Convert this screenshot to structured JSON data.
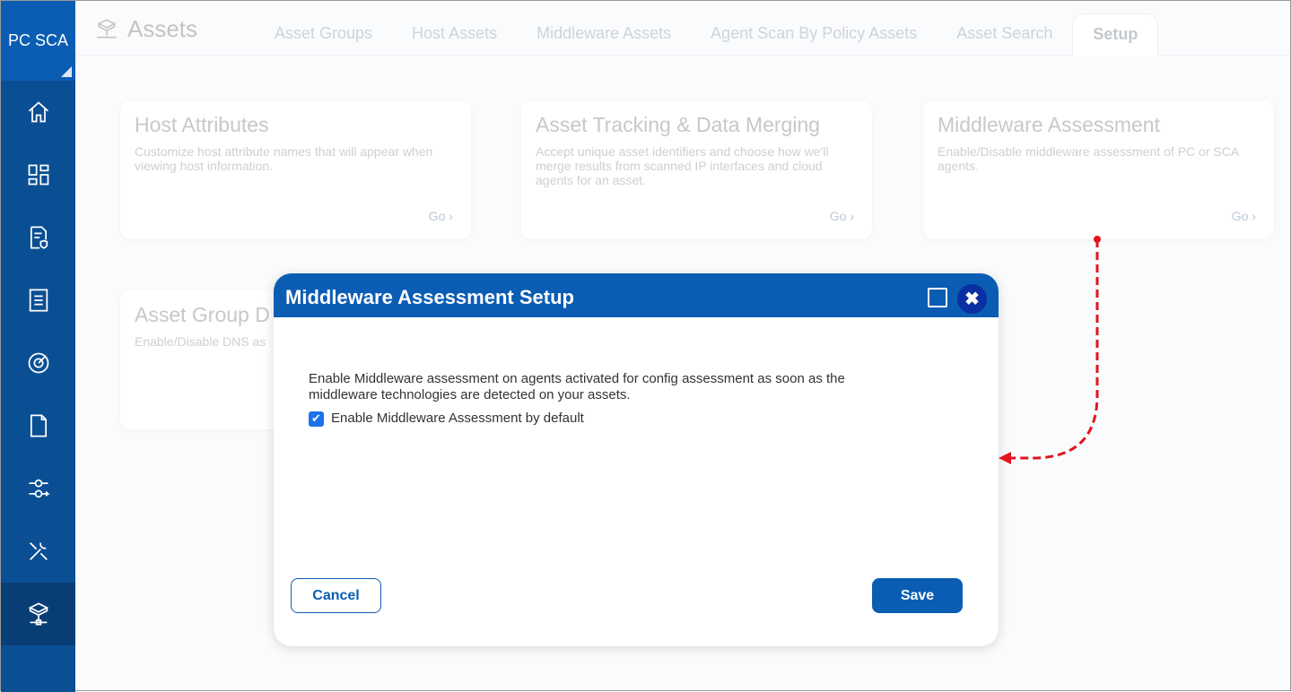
{
  "brand": "PC SCA",
  "header": {
    "title": "Assets",
    "tabs": [
      "Asset Groups",
      "Host Assets",
      "Middleware Assets",
      "Agent Scan By Policy Assets",
      "Asset Search",
      "Setup"
    ],
    "active_tab": "Setup"
  },
  "cards": [
    {
      "title": "Host Attributes",
      "desc": "Customize host attribute names that will appear when viewing host information.",
      "go": "Go"
    },
    {
      "title": "Asset Tracking & Data Merging",
      "desc": "Accept unique asset identifiers and choose how we'll merge results from scanned IP interfaces and cloud agents for an asset.",
      "go": "Go"
    },
    {
      "title": "Middleware Assessment",
      "desc": "Enable/Disable middleware assessment of PC or SCA agents.",
      "go": "Go"
    },
    {
      "title": "Asset Group D",
      "desc": "Enable/Disable DNS as"
    }
  ],
  "modal": {
    "title": "Middleware Assessment Setup",
    "description": "Enable Middleware assessment on agents activated for config assessment as soon as the middleware technologies are detected on your assets.",
    "checkbox_label": "Enable Middleware Assessment by default",
    "checked": true,
    "cancel": "Cancel",
    "save": "Save"
  },
  "colors": {
    "primary": "#0b5db3",
    "annotation": "#e0151f"
  }
}
